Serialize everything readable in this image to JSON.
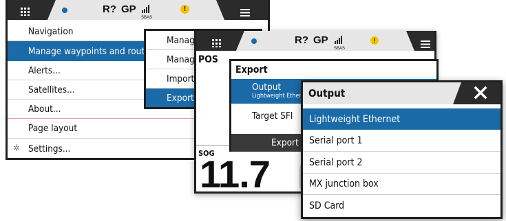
{
  "status_bar": {
    "r_label": "R?",
    "gp_label": "GP",
    "sbas_label": "SBAS",
    "warning_glyph": "!"
  },
  "main_menu": {
    "items": [
      {
        "label": "Navigation"
      },
      {
        "label": "Manage waypoints and routes"
      },
      {
        "label": "Alerts..."
      },
      {
        "label": "Satellites..."
      },
      {
        "label": "About..."
      },
      {
        "label": "Page layout"
      },
      {
        "label": "Settings..."
      }
    ]
  },
  "submenu": {
    "items": [
      {
        "label": "Manage"
      },
      {
        "label": "Manage"
      },
      {
        "label": "Import"
      },
      {
        "label": "Export"
      }
    ]
  },
  "instrument": {
    "pos_label": "POS",
    "sog_label": "SOG",
    "sog_value": "11.7"
  },
  "export_dialog": {
    "title": "Export",
    "output_label": "Output",
    "output_value": "Lightweight Ethernet",
    "target_label": "Target SFI",
    "export_button": "Export"
  },
  "output_dialog": {
    "title": "Output",
    "options": [
      {
        "label": "Lightweight Ethernet"
      },
      {
        "label": "Serial port 1"
      },
      {
        "label": "Serial port 2"
      },
      {
        "label": "MX junction box"
      },
      {
        "label": "SD Card"
      }
    ]
  },
  "colors": {
    "accent_blue": "#1a6aa8",
    "dark_bar": "#2b2b2b",
    "warning_yellow": "#f2c300"
  },
  "icons": [
    "grid-icon",
    "gps-dot-icon",
    "signal-bars-icon",
    "warning-icon",
    "menu-icon",
    "gear-icon",
    "close-icon",
    "chevron-right-icon"
  ]
}
